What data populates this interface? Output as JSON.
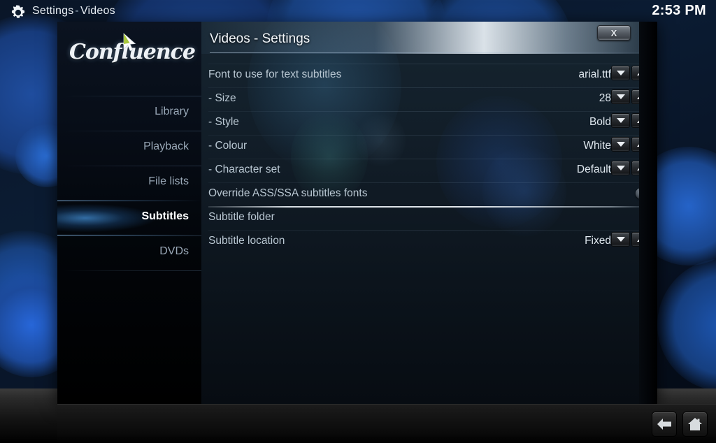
{
  "topbar": {
    "gear_icon": "gear-icon",
    "app_label": "Settings",
    "separator": "-",
    "section_label": "Videos",
    "clock": "2:53 PM"
  },
  "dialog": {
    "close_label": "X",
    "title": "Videos - Settings"
  },
  "sidebar": {
    "logo_text": "Confluence",
    "cursor_icon": "cursor-arrow-icon",
    "items": [
      {
        "label": "Library",
        "selected": false
      },
      {
        "label": "Playback",
        "selected": false
      },
      {
        "label": "File lists",
        "selected": false
      },
      {
        "label": "Subtitles",
        "selected": true
      },
      {
        "label": "DVDs",
        "selected": false
      }
    ]
  },
  "settings": {
    "rows": [
      {
        "name": "Font to use for text subtitles",
        "value": "arial.ttf",
        "control": "spinner"
      },
      {
        "name": "- Size",
        "value": "28",
        "control": "spinner"
      },
      {
        "name": "- Style",
        "value": "Bold",
        "control": "spinner"
      },
      {
        "name": "- Colour",
        "value": "White",
        "control": "spinner"
      },
      {
        "name": "- Character set",
        "value": "Default",
        "control": "spinner"
      },
      {
        "name": "Override ASS/SSA subtitles fonts",
        "value": "",
        "control": "toggle",
        "toggle_on": false,
        "bright_separator_below": true
      },
      {
        "name": "Subtitle folder",
        "value": "",
        "control": "none"
      },
      {
        "name": "Subtitle location",
        "value": "Fixed",
        "control": "spinner"
      }
    ],
    "spinner_down_icon": "chevron-down-icon",
    "spinner_up_icon": "chevron-up-icon",
    "toggle_icon": "radio-toggle-icon"
  },
  "bottomnav": {
    "back_icon": "back-arrow-icon",
    "home_icon": "home-icon"
  },
  "colors": {
    "accent_blue": "#3a7ebe",
    "bg_navy": "#0a1628",
    "panel_slate": "#16242f",
    "text_primary": "#dfe7ee",
    "text_muted": "#b9c7d2",
    "logo_green": "#a8c83c"
  }
}
